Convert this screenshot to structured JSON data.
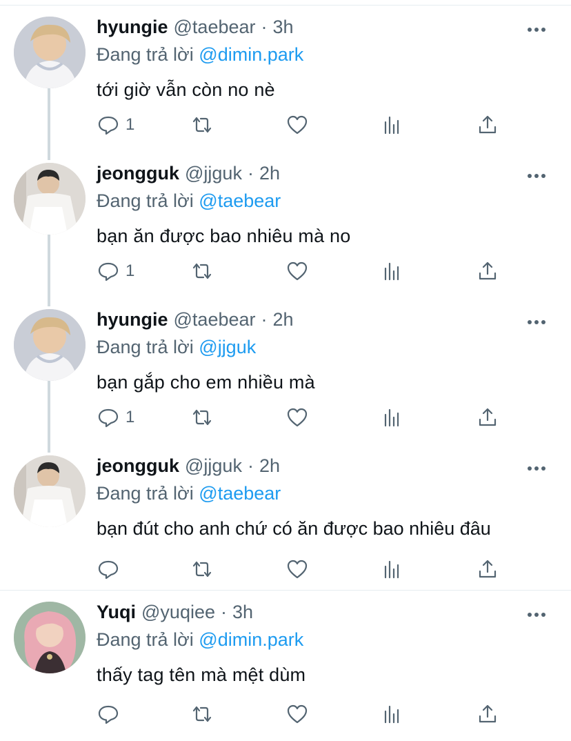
{
  "reply_prefix": "Đang trả lời",
  "separator": "·",
  "tweets": [
    {
      "name": "hyungie",
      "handle": "@taebear",
      "time": "3h",
      "reply_to": "@dimin.park",
      "text": "tới giờ vẫn còn no nè",
      "reply_count": "1"
    },
    {
      "name": "jeongguk",
      "handle": "@jjguk",
      "time": "2h",
      "reply_to": "@taebear",
      "text": "bạn ăn được bao nhiêu mà no",
      "reply_count": "1"
    },
    {
      "name": "hyungie",
      "handle": "@taebear",
      "time": "2h",
      "reply_to": "@jjguk",
      "text": "bạn gắp cho em nhiều mà",
      "reply_count": "1"
    },
    {
      "name": "jeongguk",
      "handle": "@jjguk",
      "time": "2h",
      "reply_to": "@taebear",
      "text": "bạn đút cho anh chứ có ăn được bao nhiêu đâu",
      "reply_count": ""
    },
    {
      "name": "Yuqi",
      "handle": "@yuqiee",
      "time": "3h",
      "reply_to": "@dimin.park",
      "text": "thấy tag tên mà mệt dùm",
      "reply_count": ""
    }
  ],
  "icons": {
    "reply": "reply-icon",
    "retweet": "retweet-icon",
    "like": "heart-icon",
    "stats": "stats-icon",
    "share": "share-icon",
    "more": "more-icon"
  },
  "colors": {
    "link": "#1d9bf0",
    "secondary": "#536471",
    "text": "#0f1419",
    "thread_line": "#cfd9de"
  }
}
